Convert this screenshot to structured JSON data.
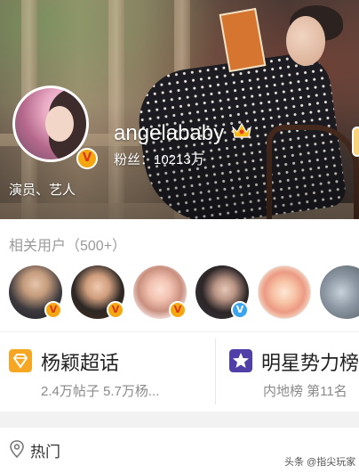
{
  "profile": {
    "username": "angelababy",
    "fans_text": "粉丝：10213万",
    "roles": "演员、艺人",
    "verified_badge": "V"
  },
  "related": {
    "title": "相关用户（500+）",
    "users": [
      {
        "badge": "V",
        "badge_color": "orange"
      },
      {
        "badge": "V",
        "badge_color": "orange"
      },
      {
        "badge": "V",
        "badge_color": "orange"
      },
      {
        "badge": "V",
        "badge_color": "blue"
      },
      {
        "badge": ""
      },
      {
        "badge": ""
      }
    ]
  },
  "cards": [
    {
      "icon": "diamond-icon",
      "title": "杨颖超话",
      "subtitle": "2.4万帖子 5.7万杨..."
    },
    {
      "icon": "star-icon",
      "title": "明星势力榜",
      "subtitle": "内地榜 第11名"
    }
  ],
  "hot": {
    "label": "热门"
  },
  "watermark": "头条 @指尖玩家",
  "colors": {
    "verify_orange": "#f4a711",
    "verify_blue": "#3aa4ee",
    "diamond": "#f5a623",
    "star": "#4f3fa6"
  }
}
